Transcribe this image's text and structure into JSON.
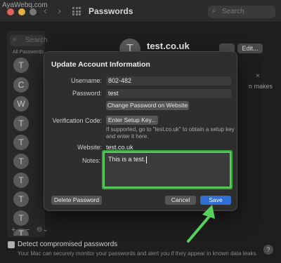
{
  "watermark": "AyaWebq.com",
  "window": {
    "title": "Passwords",
    "search_placeholder": "Search"
  },
  "sidebar": {
    "search_placeholder": "Search",
    "section_label": "All Passwords",
    "avatars": [
      "T",
      "C",
      "W",
      "T",
      "T",
      "T",
      "T",
      "T",
      "T",
      "T"
    ],
    "add": "+",
    "remove": "−",
    "more": "⊖⌄"
  },
  "detail": {
    "avatar_letter": "T",
    "title": "test.co.uk",
    "edit_label": "Edit...",
    "partial_close": "×",
    "partial_text": "n makes"
  },
  "dialog": {
    "title": "Update Account Information",
    "username_label": "Username:",
    "username_value": "802-482",
    "password_label": "Password:",
    "password_value": "test",
    "change_password_button": "Change Password on Website",
    "verification_label": "Verification Code:",
    "setup_key_button": "Enter Setup Key...",
    "verification_hint": "If supported, go to \"test.co.uk\" to obtain a setup key and enter it here.",
    "website_label": "Website:",
    "website_value": "test.co.uk",
    "notes_label": "Notes:",
    "notes_value": "This is a test.",
    "delete_button": "Delete Password",
    "cancel_button": "Cancel",
    "save_button": "Save"
  },
  "footer": {
    "detect_label": "Detect compromised passwords",
    "detect_description": "Your Mac can securely monitor your passwords and alert you if they appear in known data leaks.",
    "help": "?"
  },
  "colors": {
    "highlight": "#57d05c",
    "accent": "#2f6fd6"
  }
}
